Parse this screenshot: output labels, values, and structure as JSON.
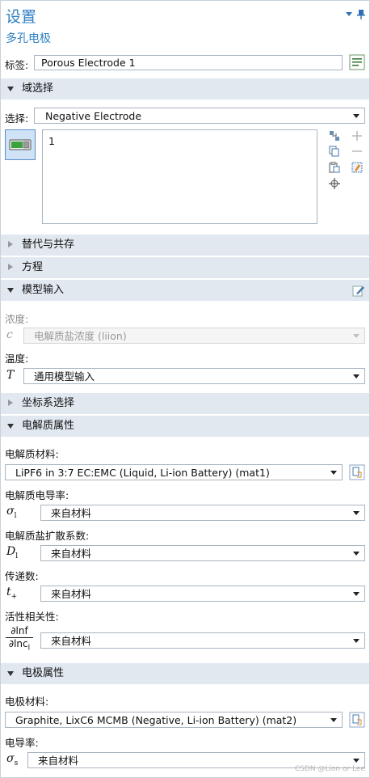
{
  "header": {
    "title": "设置",
    "subtitle": "多孔电极"
  },
  "label_row": {
    "label": "标签:",
    "value": "Porous Electrode 1"
  },
  "domain_section": {
    "title": "域选择",
    "select_label": "选择:",
    "select_value": "Negative Electrode",
    "list_items": [
      "1"
    ]
  },
  "sections": {
    "override": "替代与共存",
    "equation": "方程",
    "model_input": "模型输入",
    "coord_system": "坐标系选择",
    "electrolyte_props": "电解质属性",
    "electrode_props": "电极属性"
  },
  "model_input": {
    "concentration_label": "浓度:",
    "concentration_symbol": "c",
    "concentration_value": "电解质盐浓度 (liion)",
    "temperature_label": "温度:",
    "temperature_symbol": "T",
    "temperature_value": "通用模型输入"
  },
  "electrolyte": {
    "material_label": "电解质材料:",
    "material_value": "LiPF6 in 3:7 EC:EMC (Liquid, Li-ion Battery) (mat1)",
    "conductivity_label": "电解质电导率:",
    "conductivity_symbol": "σ",
    "conductivity_sub": "l",
    "conductivity_value": "来自材料",
    "diffusion_label": "电解质盐扩散系数:",
    "diffusion_symbol": "D",
    "diffusion_sub": "l",
    "diffusion_value": "来自材料",
    "transference_label": "传递数:",
    "transference_symbol": "t",
    "transference_sub": "+",
    "transference_value": "来自材料",
    "activity_label": "活性相关性:",
    "activity_num": "∂lnf",
    "activity_den": "∂lnc",
    "activity_den_sub": "l",
    "activity_value": "来自材料"
  },
  "electrode": {
    "material_label": "电极材料:",
    "material_value": "Graphite, LixC6 MCMB (Negative, Li-ion Battery) (mat2)",
    "conductivity_label": "电导率:",
    "conductivity_symbol": "σ",
    "conductivity_sub": "s",
    "conductivity_value": "来自材料"
  },
  "watermark": "CSDN @Lion or Lee",
  "colors": {
    "accent": "#2e7fc3",
    "section_bg": "#e1e8f0",
    "border": "#a9b4bf"
  }
}
